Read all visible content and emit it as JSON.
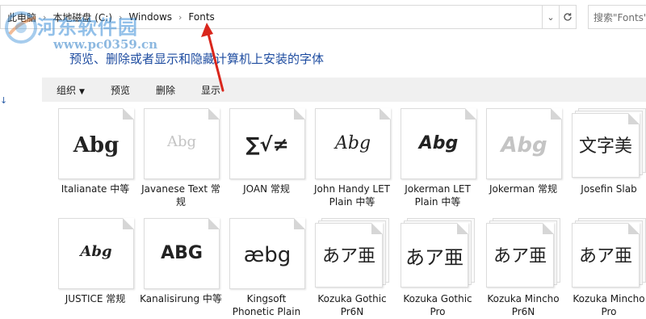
{
  "address_bar": {
    "crumbs": [
      "此电脑",
      "本地磁盘 (C:)",
      "Windows",
      "Fonts"
    ],
    "dropdown_icon": "chevron-down-icon",
    "refresh_icon": "refresh-icon"
  },
  "search": {
    "placeholder": "搜索\"Fonts\""
  },
  "watermark": {
    "title": "河东软件园",
    "url": "www.pc0359.cn"
  },
  "headline": "预览、删除或者显示和隐藏计算机上安装的字体",
  "toolbar": {
    "organize": "组织",
    "preview": "预览",
    "delete": "删除",
    "show": "显示"
  },
  "fonts": [
    {
      "sample": "Abg",
      "label": "Italianate 中等",
      "stacked": false,
      "faded": false
    },
    {
      "sample": "Abg",
      "label": "Javanese Text 常规",
      "stacked": false,
      "faded": true
    },
    {
      "sample": "∑√≠",
      "label": "JOAN 常规",
      "stacked": false,
      "faded": false
    },
    {
      "sample": "Abg",
      "label": "John Handy LET Plain 中等",
      "stacked": false,
      "faded": false
    },
    {
      "sample": "Abg",
      "label": "Jokerman LET Plain 中等",
      "stacked": false,
      "faded": false
    },
    {
      "sample": "Abg",
      "label": "Jokerman 常规",
      "stacked": false,
      "faded": true
    },
    {
      "sample": "文字美",
      "label": "Josefin Slab",
      "stacked": true,
      "faded": false
    },
    {
      "sample": "Abg",
      "label": "JUSTICE 常规",
      "stacked": false,
      "faded": false
    },
    {
      "sample": "ABG",
      "label": "Kanalisirung 中等",
      "stacked": false,
      "faded": false
    },
    {
      "sample": "æbg",
      "label": "Kingsoft Phonetic Plain",
      "stacked": false,
      "faded": false
    },
    {
      "sample": "あア亜",
      "label": "Kozuka Gothic Pr6N",
      "stacked": true,
      "faded": false
    },
    {
      "sample": "あア亜",
      "label": "Kozuka Gothic Pro",
      "stacked": true,
      "faded": false
    },
    {
      "sample": "あア亜",
      "label": "Kozuka Mincho Pr6N",
      "stacked": true,
      "faded": false
    },
    {
      "sample": "あア亜",
      "label": "Kozuka Mincho Pro",
      "stacked": true,
      "faded": false
    }
  ],
  "annotation_color": "#d9261c"
}
